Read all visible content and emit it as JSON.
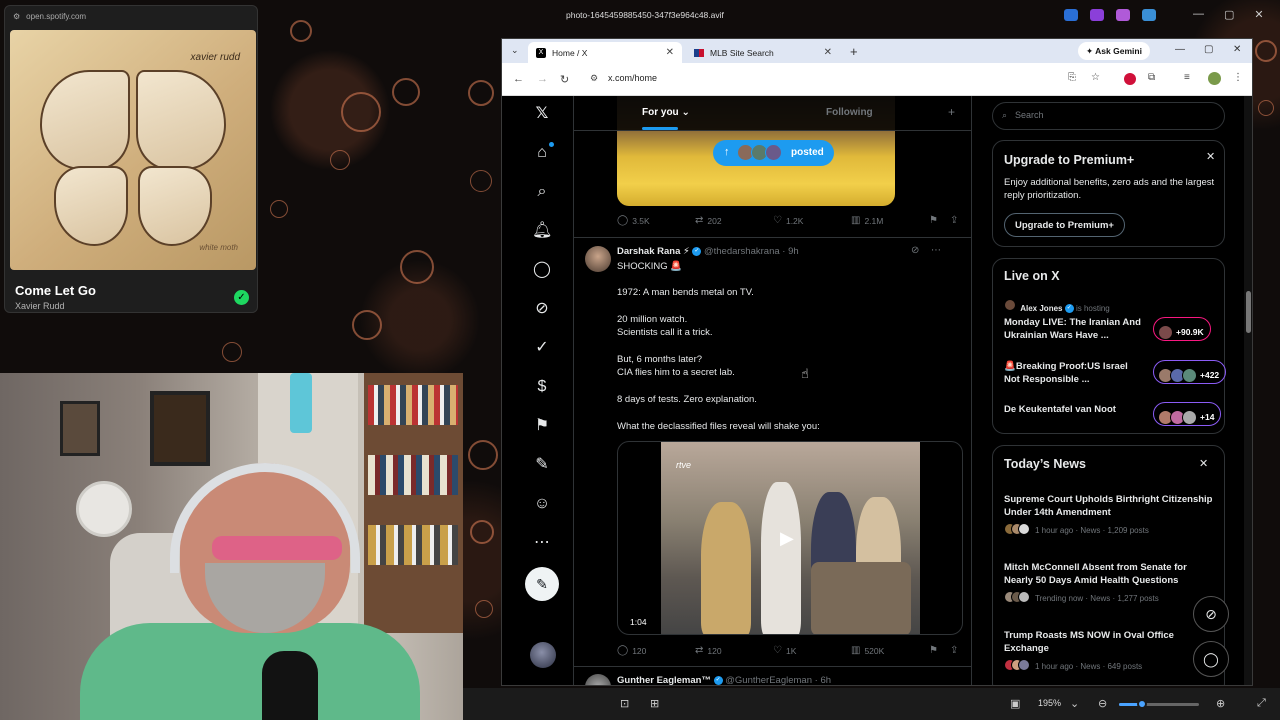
{
  "desktop": {
    "image_title": "photo-1645459885450-347f3e964c48.avif"
  },
  "spotify": {
    "url": "open.spotify.com",
    "album_artist_script": "xavier rudd",
    "album_title_script": "white moth",
    "song_title": "Come Let Go",
    "artist": "Xavier Rudd",
    "saved_icon": "check-icon"
  },
  "viewer": {
    "zoom": "195%"
  },
  "browser": {
    "tabs": [
      {
        "title": "Home / X",
        "active": true
      },
      {
        "title": "MLB Site Search",
        "active": false
      }
    ],
    "ask_gemini": "Ask Gemini",
    "url": "x.com/home"
  },
  "timeline": {
    "tabs": {
      "for_you": "For you",
      "following": "Following"
    },
    "posted_label": "posted",
    "prev_post_stats": {
      "replies": "3.5K",
      "reposts": "202",
      "likes": "1.2K",
      "views": "2.1M"
    },
    "post": {
      "name": "Darshak Rana",
      "emoji": "⚡",
      "handle": "@thedarshakrana",
      "time": "9h",
      "lines": [
        "SHOCKING 🚨",
        "1972: A man bends metal on TV.",
        "20 million watch.",
        "Scientists call it a trick.",
        "But, 6 months later?",
        "CIA flies him to a secret lab.",
        "8 days of tests. Zero explanation.",
        "What the declassified files reveal will shake you:"
      ],
      "video_duration": "1:04",
      "video_logo": "rtve",
      "stats": {
        "replies": "120",
        "reposts": "120",
        "likes": "1K",
        "views": "520K"
      }
    },
    "next_post": {
      "name": "Gunther Eagleman™",
      "handle": "@GuntherEagleman",
      "time": "6h"
    }
  },
  "sidebar": {
    "search_placeholder": "Search",
    "premium": {
      "title": "Upgrade to Premium+",
      "description": "Enjoy additional benefits, zero ads and the largest reply prioritization.",
      "button": "Upgrade to Premium+"
    },
    "live": {
      "title": "Live on X",
      "host": "Alex Jones",
      "host_suffix": "is hosting",
      "items": [
        {
          "title": "Monday LIVE: The Iranian And Ukrainian Wars Have ...",
          "count": "+90.9K"
        },
        {
          "title": "🚨Breaking Proof:US Israel Not Responsible ...",
          "count": "+422"
        },
        {
          "title": "De Keukentafel van Noot",
          "count": "+14"
        }
      ]
    },
    "news": {
      "title": "Today’s News",
      "items": [
        {
          "title": "Supreme Court Upholds Birthright Citizenship Under 14th Amendment",
          "meta": "1 hour ago · News · 1,209 posts"
        },
        {
          "title": "Mitch McConnell Absent from Senate for Nearly 50 Days Amid Health Questions",
          "meta": "Trending now · News · 1,277 posts"
        },
        {
          "title": "Trump Roasts MS NOW in Oval Office Exchange",
          "meta": "1 hour ago · News · 649 posts"
        }
      ]
    }
  },
  "colors": {
    "accent": "#1d9bf0",
    "spotify_green": "#1ed760",
    "live_purple": "#8b5cf6",
    "live_red": "#f91880"
  }
}
